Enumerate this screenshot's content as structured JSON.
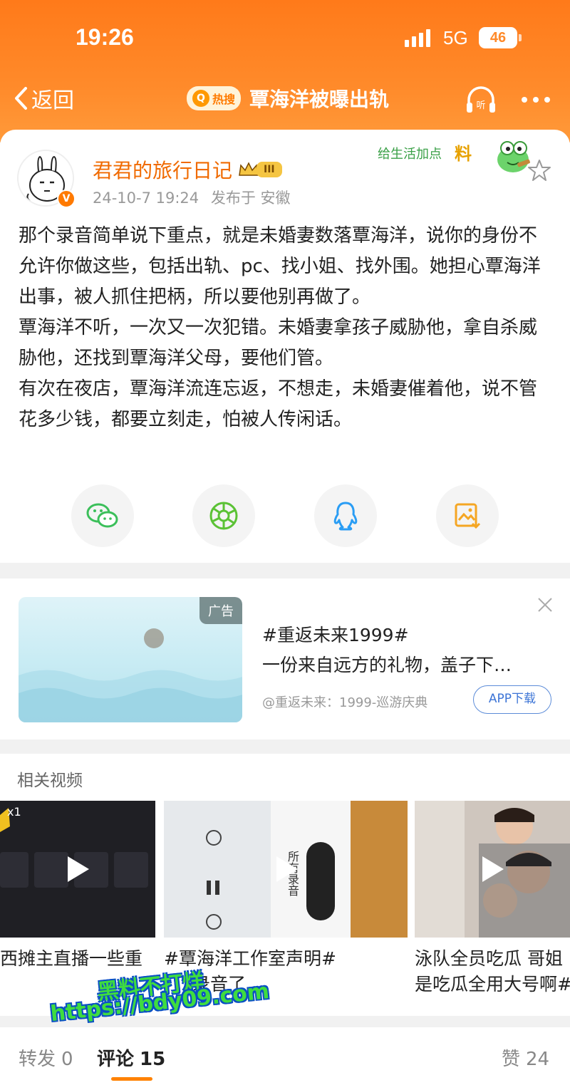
{
  "status_bar": {
    "time": "19:26",
    "network": "5G",
    "battery": "46"
  },
  "nav": {
    "back_label": "返回",
    "hot_tag": "热搜",
    "title": "覃海洋被曝出轨"
  },
  "post": {
    "author": "君君的旅行日记",
    "level_badge": "III",
    "verified_mark": "V",
    "timestamp": "24-10-7 19:24",
    "location": "发布于 安徽",
    "sticker_text": "给生活加点",
    "sticker_word": "料",
    "paragraphs": [
      "那个录音简单说下重点，就是未婚妻数落覃海洋，说你的身份不允许你做这些，包括出轨、pc、找小姐、找外围。她担心覃海洋出事，被人抓住把柄，所以要他别再做了。",
      "覃海洋不听，一次又一次犯错。未婚妻拿孩子威胁他，拿自杀威胁他，还找到覃海洋父母，要他们管。",
      "有次在夜店，覃海洋流连忘返，不想走，未婚妻催着他，说不管花多少钱，都要立刻走，怕被人传闲话。"
    ],
    "share_icons": [
      "wechat-icon",
      "moments-icon",
      "qq-icon",
      "save-image-icon"
    ]
  },
  "ad": {
    "tag": "广告",
    "title": "#重返未来1999#",
    "description": "一份来自远方的礼物，盖子下…",
    "source": "@重返未来：1999-巡游庆典",
    "button": "APP下载"
  },
  "related_videos": {
    "title": "相关视频",
    "items": [
      {
        "caption": "西摊主直播一些重",
        "overlay": "x1"
      },
      {
        "caption": "#覃海洋工作室声明#",
        "caption2": "录音了",
        "overlay": "所有录音"
      },
      {
        "caption": "泳队全员吃瓜 哥姐",
        "caption2": "是吃瓜全用大号啊#"
      }
    ]
  },
  "watermark": {
    "line1": "黑料不打烊",
    "line2": "https://bdy09.com"
  },
  "tabs": {
    "repost_label": "转发",
    "repost_count": "0",
    "comment_label": "评论",
    "comment_count": "15",
    "like_label": "赞",
    "like_count": "24"
  },
  "colors": {
    "brand_orange": "#ff8a2a",
    "author_orange": "#f06a00",
    "link_blue": "#3c74d6"
  }
}
